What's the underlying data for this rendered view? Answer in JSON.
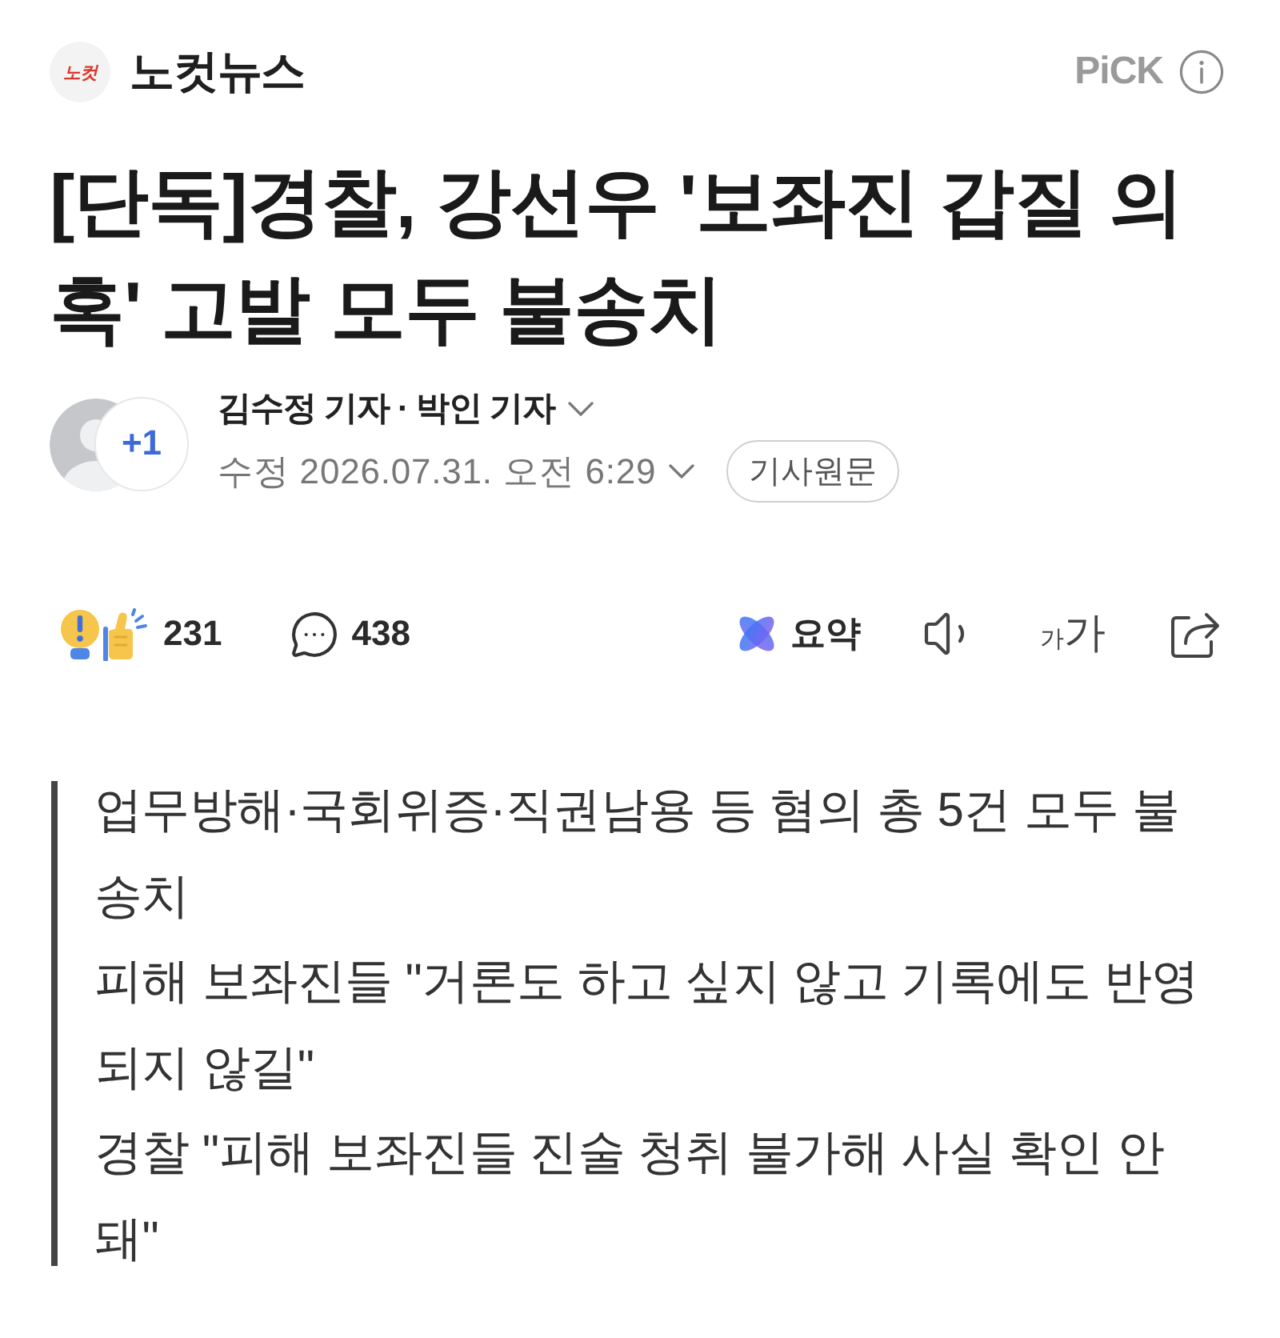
{
  "header": {
    "logo_text": "노컷",
    "press_name": "노컷뉴스",
    "pick_label": "PiCK"
  },
  "headline": "[단독]경찰, 강선우 '보좌진 갑질 의혹' 고발 모두 불송치",
  "byline": {
    "more_authors": "+1",
    "authors": "김수정 기자 · 박인 기자",
    "date": "수정 2026.07.31. 오전 6:29",
    "original_button": "기사원문"
  },
  "action_bar": {
    "left": [
      {
        "kind": "reaction",
        "label": "231"
      },
      {
        "kind": "comment",
        "label": "438"
      }
    ],
    "right": [
      {
        "kind": "summary",
        "label": "요약"
      },
      {
        "kind": "speaker"
      },
      {
        "kind": "font_size",
        "small": "가",
        "large": "가"
      },
      {
        "kind": "share"
      }
    ]
  },
  "summary": [
    "업무방해·국회위증·직권남용 등 혐의 총 5건 모두 불송치",
    "피해 보좌진들 \"거론도 하고 싶지 않고 기록에도 반영되지 않길\"",
    "경찰 \"피해 보좌진들 진술 청취 불가해 사실 확인 안 돼\""
  ]
}
